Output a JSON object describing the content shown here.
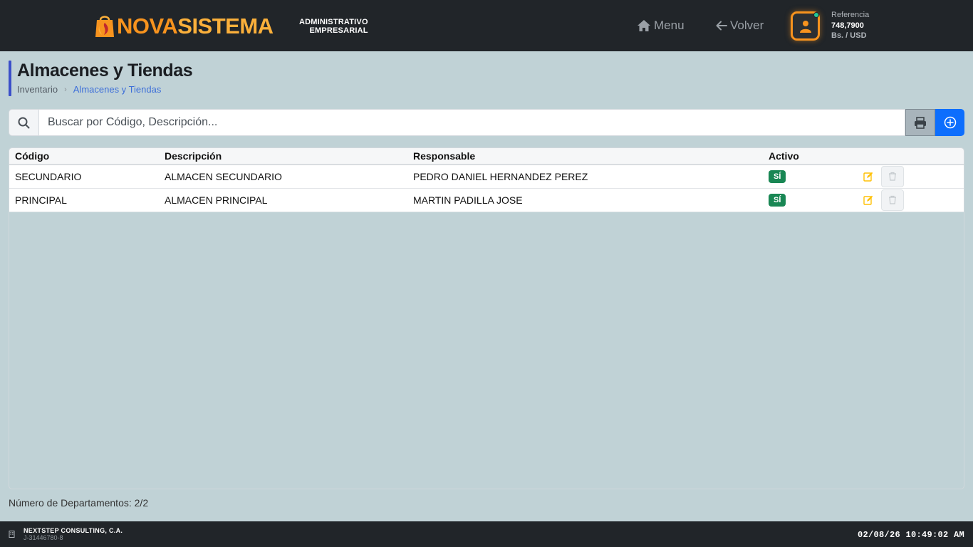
{
  "header": {
    "brand_part1": "NOVA",
    "brand_part2": "SISTEMA",
    "brand_sub1": "ADMINISTRATIVO",
    "brand_sub2": "EMPRESARIAL",
    "menu_label": "Menu",
    "back_label": "Volver",
    "reference": {
      "label": "Referencia",
      "value": "748,7900",
      "currency": "Bs. / USD"
    }
  },
  "page": {
    "title": "Almacenes y Tiendas",
    "breadcrumb": [
      "Inventario",
      "Almacenes y Tiendas"
    ]
  },
  "search": {
    "placeholder": "Buscar por Código, Descripción...",
    "value": ""
  },
  "table": {
    "columns": [
      "Código",
      "Descripción",
      "Responsable",
      "Activo"
    ],
    "rows": [
      {
        "codigo": "SECUNDARIO",
        "descripcion": "ALMACEN SECUNDARIO",
        "responsable": "PEDRO DANIEL HERNANDEZ PEREZ",
        "activo": "SÍ"
      },
      {
        "codigo": "PRINCIPAL",
        "descripcion": "ALMACEN PRINCIPAL",
        "responsable": "MARTIN PADILLA JOSE",
        "activo": "SÍ"
      }
    ]
  },
  "summary": {
    "count_text": "Número de Departamentos: 2/2"
  },
  "footer": {
    "company": "NEXTSTEP CONSULTING, C.A.",
    "rif": "J-31446780-8",
    "datetime": "02/08/26 10:49:02 AM"
  },
  "colors": {
    "topbar": "#212529",
    "background": "#c0d2d6",
    "brand_orange": "#f7931e",
    "primary": "#0d6efd",
    "success": "#198754",
    "warning": "#ffc107",
    "title_accent": "#3b4fc9"
  },
  "icons": {
    "logo": "shopping-bag-flame-icon",
    "menu": "home-icon",
    "back": "arrow-left-icon",
    "avatar": "user-icon",
    "search": "search-icon",
    "print": "printer-icon",
    "add": "plus-circle-icon",
    "edit": "edit-icon",
    "delete": "trash-icon",
    "footer": "building-icon"
  }
}
